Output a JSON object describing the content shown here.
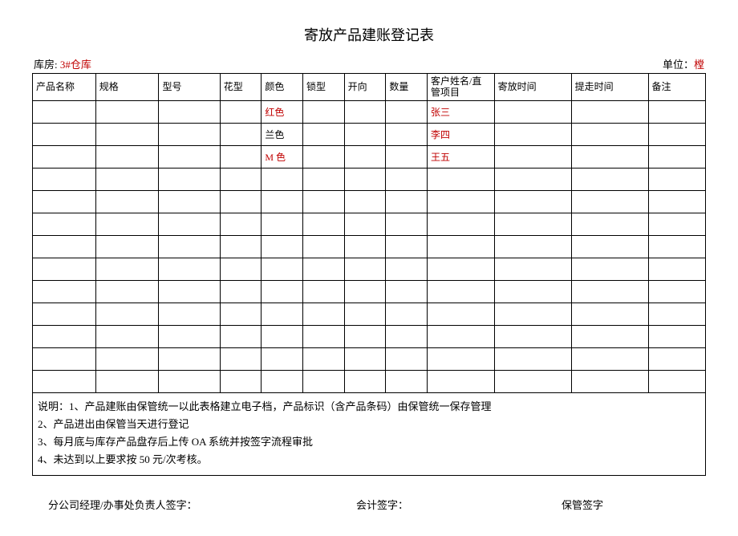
{
  "title": "寄放产品建账登记表",
  "meta": {
    "left_label": "库房: ",
    "left_value": "3#仓库",
    "right_label": "单位：",
    "right_value": "樘"
  },
  "headers": [
    "产品名称",
    "规格",
    "型号",
    "花型",
    "颜色",
    "锁型",
    "开向",
    "数量",
    "客户姓名/直管项目",
    "寄放时间",
    "提走时间",
    "备注"
  ],
  "rows": [
    {
      "color": {
        "text": "红色",
        "red": true
      },
      "cust": {
        "text": "张三",
        "red": true
      }
    },
    {
      "color": {
        "text": "兰色",
        "red": false
      },
      "cust": {
        "text": "李四",
        "red": true
      }
    },
    {
      "color": {
        "text": "M 色",
        "red": true
      },
      "cust": {
        "text": "王五",
        "red": true
      }
    },
    {},
    {},
    {},
    {},
    {},
    {},
    {},
    {},
    {},
    {}
  ],
  "notes": [
    "说明：1、产品建账由保管统一以此表格建立电子档，产品标识（含产品条码）由保管统一保存管理",
    "2、产品进出由保管当天进行登记",
    "3、每月底与库存产品盘存后上传 OA 系统并按签字流程审批",
    "4、未达到以上要求按 50 元/次考核。"
  ],
  "sign": {
    "manager": "分公司经理/办事处负责人签字：",
    "accountant": "会计签字：",
    "keeper": "保管签字"
  }
}
